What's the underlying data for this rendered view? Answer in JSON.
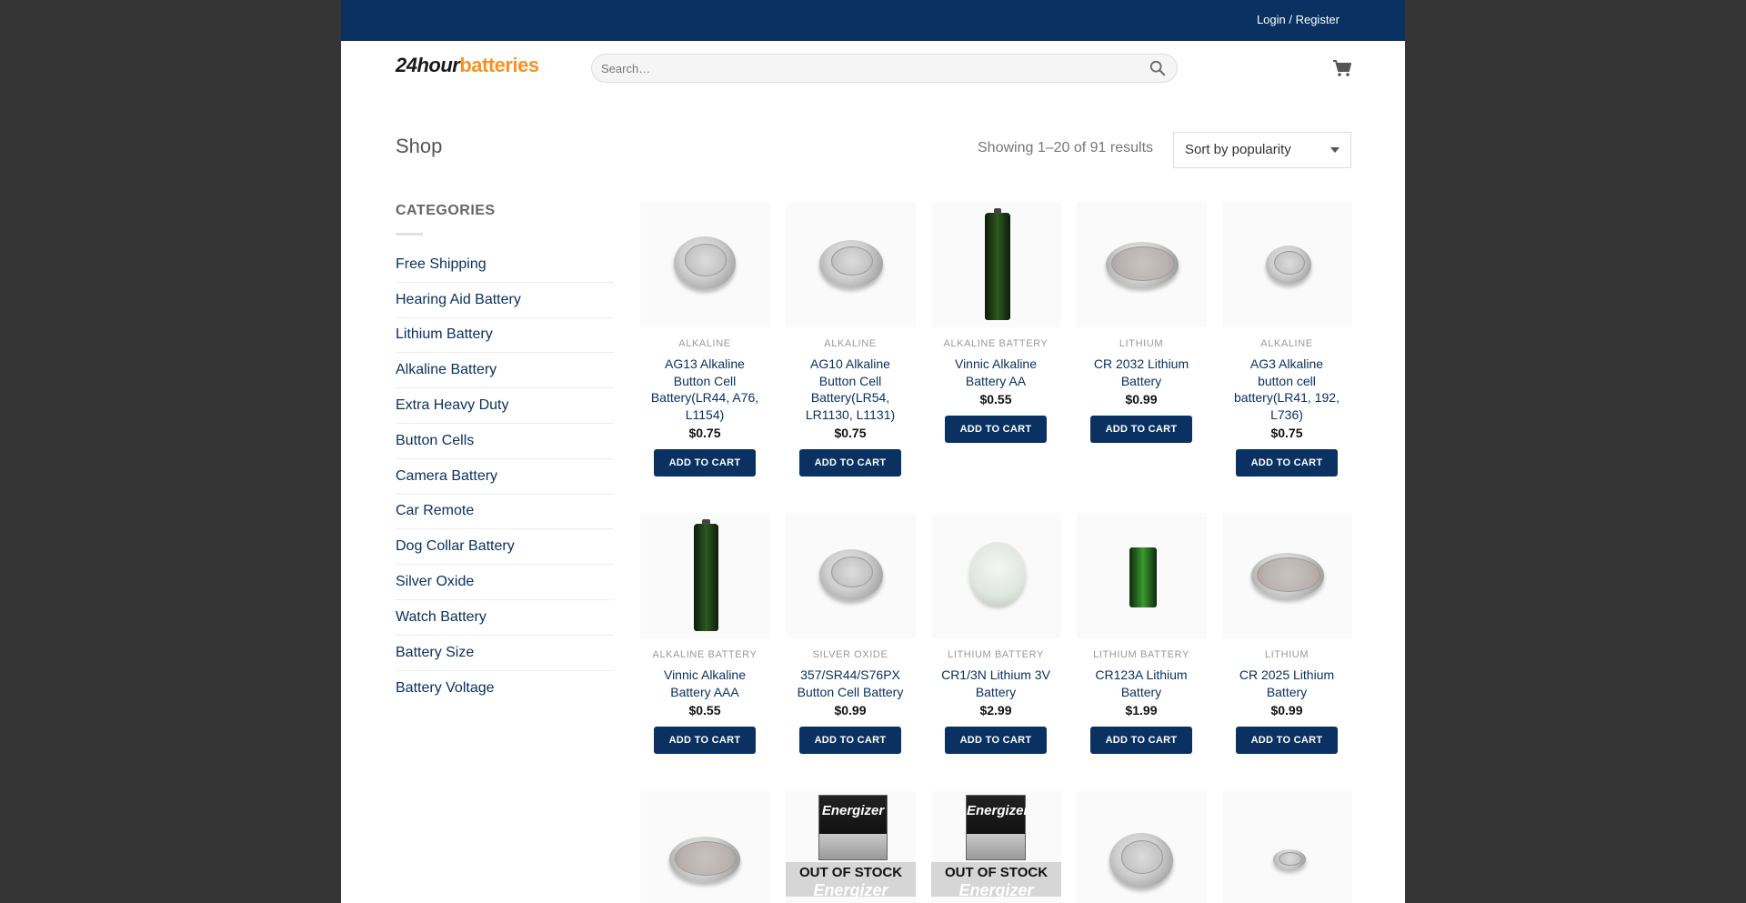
{
  "topbar": {
    "login": "Login / Register"
  },
  "logo": {
    "part1": "24hour",
    "part2": "batteries"
  },
  "search": {
    "placeholder": "Search…"
  },
  "shop": {
    "title": "Shop",
    "results": "Showing 1–20 of 91 results",
    "sort": "Sort by popularity"
  },
  "sidebar": {
    "heading": "CATEGORIES",
    "items": [
      "Free Shipping",
      "Hearing Aid Battery",
      "Lithium Battery",
      "Alkaline Battery",
      "Extra Heavy Duty",
      "Button Cells",
      "Camera Battery",
      "Car Remote",
      "Dog Collar Battery",
      "Silver Oxide",
      "Watch Battery",
      "Battery Size",
      "Battery Voltage"
    ]
  },
  "add_to_cart": "ADD TO CART",
  "out_of_stock": "OUT OF STOCK",
  "pack_brand": "Energizer",
  "products": [
    {
      "cat": "ALKALINE",
      "name": "AG13 Alkaline Button Cell Battery(LR44, A76, L1154)",
      "price": "$0.75",
      "img": "coin"
    },
    {
      "cat": "ALKALINE",
      "name": "AG10 Alkaline Button Cell Battery(LR54, LR1130, L1131)",
      "price": "$0.75",
      "img": "coin"
    },
    {
      "cat": "ALKALINE BATTERY",
      "name": "Vinnic Alkaline Battery AA",
      "price": "$0.55",
      "img": "aa"
    },
    {
      "cat": "LITHIUM",
      "name": "CR 2032 Lithium Battery",
      "price": "$0.99",
      "img": "flatcoin"
    },
    {
      "cat": "ALKALINE",
      "name": "AG3 Alkaline button cell battery(LR41, 192, L736)",
      "price": "$0.75",
      "img": "smallcoin"
    },
    {
      "cat": "ALKALINE BATTERY",
      "name": "Vinnic Alkaline Battery AAA",
      "price": "$0.55",
      "img": "aa"
    },
    {
      "cat": "SILVER OXIDE",
      "name": "357/SR44/S76PX Button Cell Battery",
      "price": "$0.99",
      "img": "coin"
    },
    {
      "cat": "LITHIUM BATTERY",
      "name": "CR1/3N Lithium 3V Battery",
      "price": "$2.99",
      "img": "cr1"
    },
    {
      "cat": "LITHIUM BATTERY",
      "name": "CR123A Lithium Battery",
      "price": "$1.99",
      "img": "cr123"
    },
    {
      "cat": "LITHIUM",
      "name": "CR 2025 Lithium Battery",
      "price": "$0.99",
      "img": "flatcoin"
    }
  ],
  "colors": {
    "topbar": "#0a3161",
    "accent": "#f7921e",
    "button": "#0a3161",
    "page_bg": "#353535"
  },
  "icons": {
    "search": "search-icon",
    "cart": "cart-icon"
  }
}
